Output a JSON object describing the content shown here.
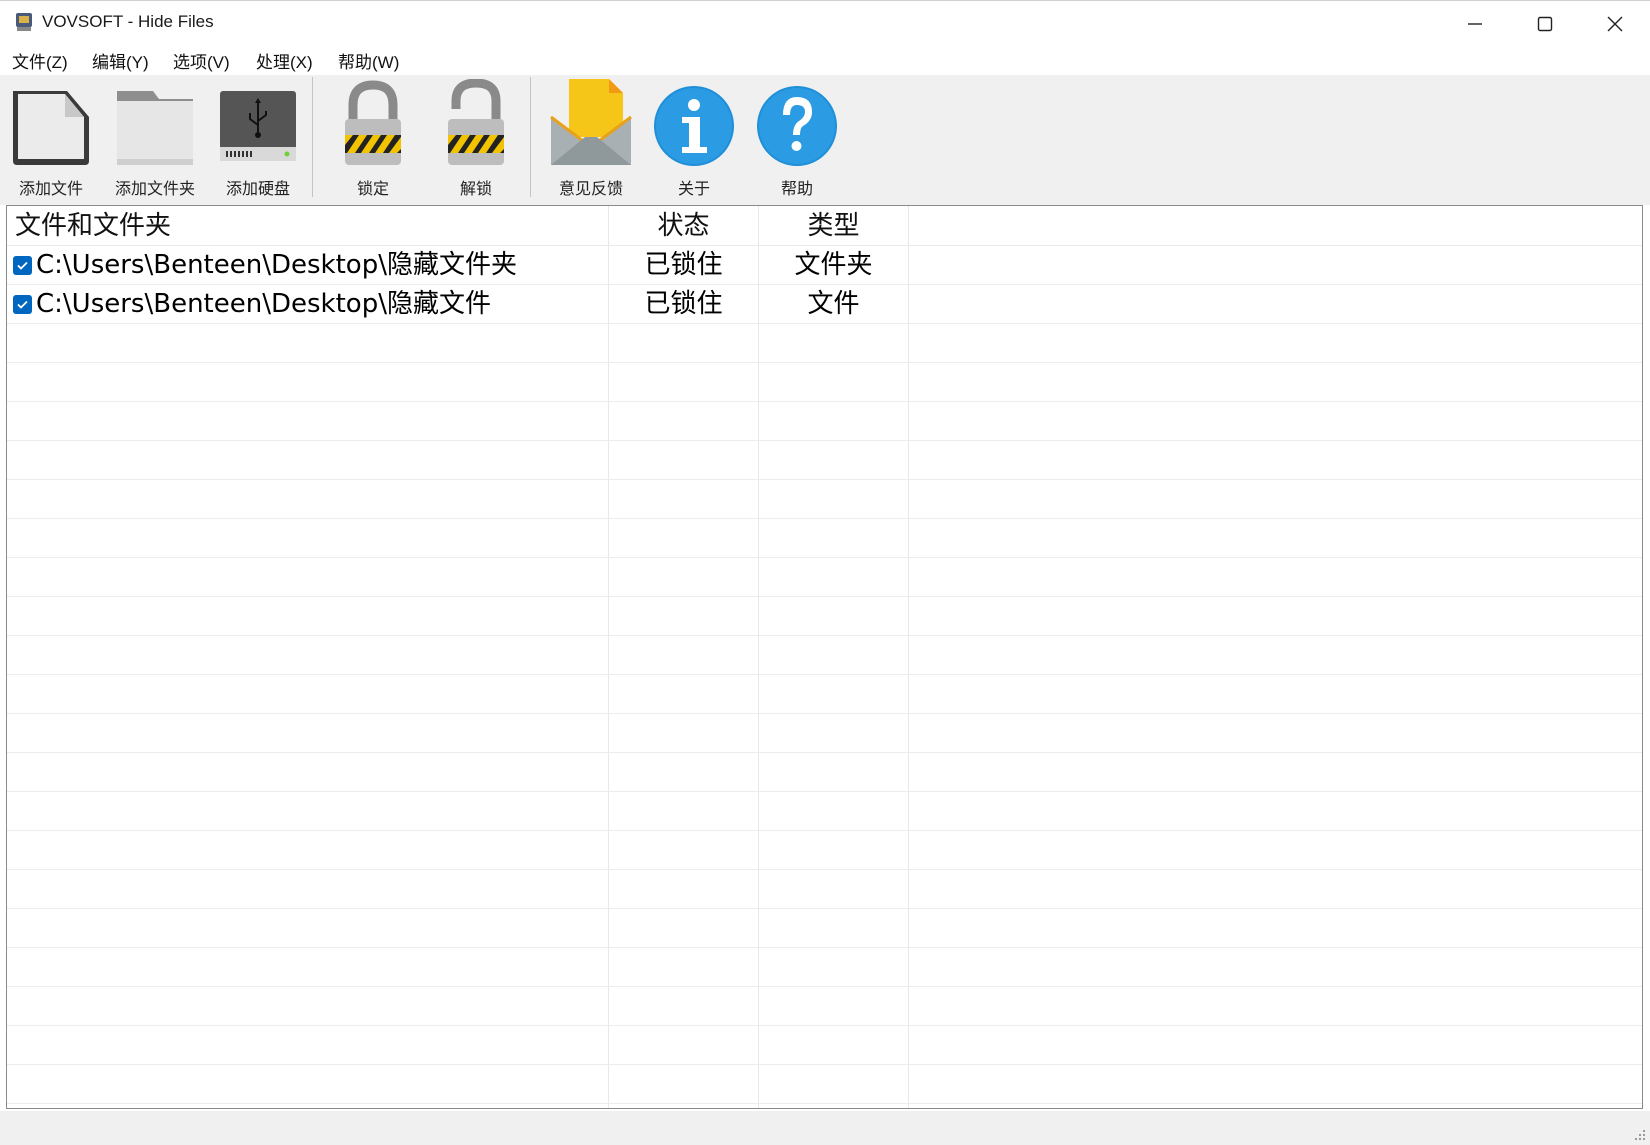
{
  "window": {
    "title": "VOVSOFT - Hide Files",
    "controls": [
      "minimize",
      "maximize",
      "close"
    ]
  },
  "menu": [
    {
      "label": "文件(Z)"
    },
    {
      "label": "编辑(Y)"
    },
    {
      "label": "选项(V)"
    },
    {
      "label": "处理(X)"
    },
    {
      "label": "帮助(W)"
    }
  ],
  "toolbar": {
    "add_file": {
      "label": "添加文件",
      "icon": "document-icon"
    },
    "add_folder": {
      "label": "添加文件夹",
      "icon": "folder-icon"
    },
    "add_drive": {
      "label": "添加硬盘",
      "icon": "usb-drive-icon"
    },
    "lock": {
      "label": "锁定",
      "icon": "padlock-closed-icon"
    },
    "unlock": {
      "label": "解锁",
      "icon": "padlock-open-icon"
    },
    "feedback": {
      "label": "意见反馈",
      "icon": "envelope-icon"
    },
    "about": {
      "label": "关于",
      "icon": "info-icon"
    },
    "help": {
      "label": "帮助",
      "icon": "question-icon"
    }
  },
  "list": {
    "columns": {
      "path": "文件和文件夹",
      "status": "状态",
      "type": "类型"
    },
    "rows": [
      {
        "checked": true,
        "path": "C:\\Users\\Benteen\\Desktop\\隐藏文件夹",
        "status": "已锁住",
        "type": "文件夹"
      },
      {
        "checked": true,
        "path": "C:\\Users\\Benteen\\Desktop\\隐藏文件",
        "status": "已锁住",
        "type": "文件"
      }
    ]
  },
  "colors": {
    "checkbox": "#0067c0",
    "info_blue": "#1e8fd8",
    "envelope_yellow": "#f5c518"
  }
}
